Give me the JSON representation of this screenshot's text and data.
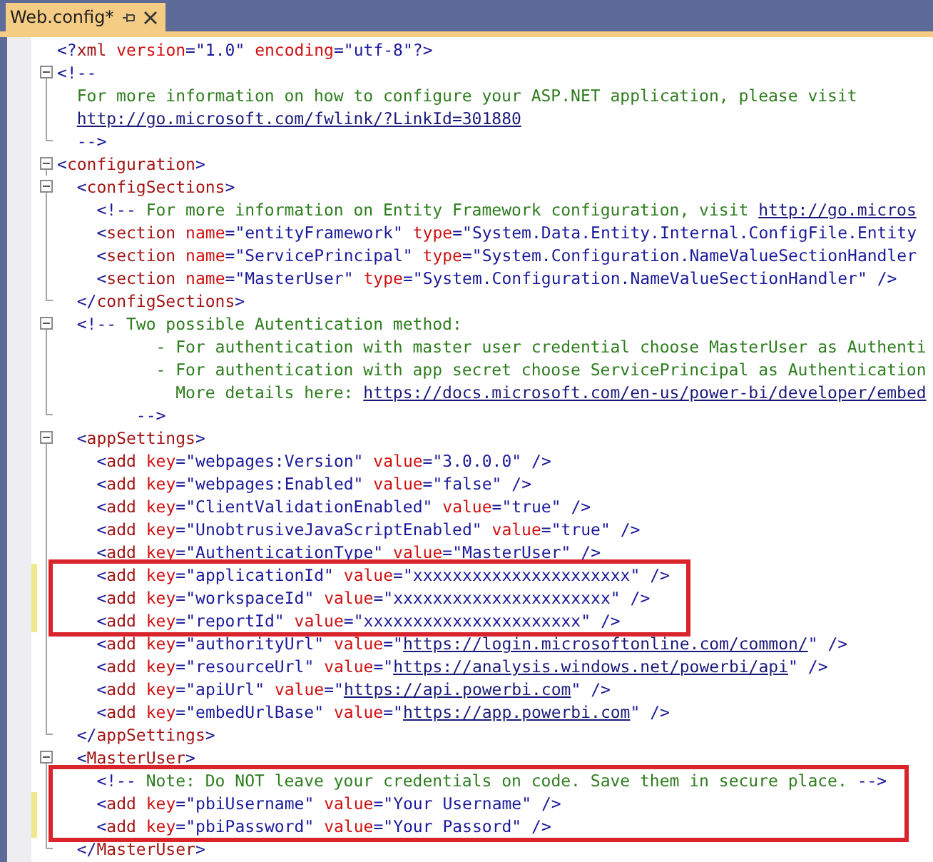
{
  "tab": {
    "title": "Web.config*",
    "selected": true
  },
  "editor": {
    "blocks": [
      {
        "highlighted": false,
        "lines": [
          {
            "kind": "plain",
            "modified": false,
            "segments": [
              {
                "kind": "markup",
                "text": "<?xml version=\"1.0\" encoding=\"utf-8\"?>"
              }
            ]
          },
          {
            "kind": "start",
            "expanded": true,
            "modified": false,
            "segments": [
              {
                "kind": "comment",
                "text": "<!--"
              }
            ]
          },
          {
            "kind": "line",
            "modified": false,
            "segments": [
              {
                "kind": "comment",
                "text": "  For more information on how to configure your ASP.NET application, please visit"
              }
            ]
          },
          {
            "kind": "line",
            "modified": false,
            "segments": [
              {
                "kind": "link",
                "text": "  http://go.microsoft.com/fwlink/?LinkId=301880"
              }
            ]
          },
          {
            "kind": "end",
            "modified": false,
            "segments": [
              {
                "kind": "comment",
                "text": "  -->"
              }
            ]
          },
          {
            "kind": "start",
            "expanded": true,
            "modified": false,
            "segments": [
              {
                "kind": "markup",
                "text": "<configuration>"
              }
            ]
          },
          {
            "kind": "start",
            "expanded": true,
            "modified": false,
            "segments": [
              {
                "kind": "markup",
                "text": "  <configSections>"
              }
            ]
          },
          {
            "kind": "line",
            "modified": false,
            "segments": [
              {
                "kind": "comment",
                "text": "    <!-- For more information on Entity Framework configuration, visit "
              },
              {
                "kind": "link",
                "text": "http://go.micros"
              }
            ]
          },
          {
            "kind": "line",
            "modified": false,
            "segments": [
              {
                "kind": "markup",
                "text": "    <section name=\"entityFramework\" type=\"System.Data.Entity.Internal.ConfigFile.Entity"
              }
            ]
          },
          {
            "kind": "line",
            "modified": false,
            "segments": [
              {
                "kind": "markup",
                "text": "    <section name=\"ServicePrincipal\" type=\"System.Configuration.NameValueSectionHandler"
              }
            ]
          },
          {
            "kind": "line",
            "modified": false,
            "segments": [
              {
                "kind": "markup",
                "text": "    <section name=\"MasterUser\" type=\"System.Configuration.NameValueSectionHandler\" />"
              }
            ]
          },
          {
            "kind": "end",
            "modified": false,
            "segments": [
              {
                "kind": "markup",
                "text": "  </configSections>"
              }
            ]
          },
          {
            "kind": "start",
            "expanded": true,
            "modified": false,
            "segments": [
              {
                "kind": "comment",
                "text": "  <!-- Two possible Autentication method:"
              }
            ]
          },
          {
            "kind": "line",
            "modified": false,
            "segments": [
              {
                "kind": "comment",
                "text": "          - For authentication with master user credential choose MasterUser as Authenti"
              }
            ]
          },
          {
            "kind": "line",
            "modified": false,
            "segments": [
              {
                "kind": "comment",
                "text": "          - For authentication with app secret choose ServicePrincipal as Authentication"
              }
            ]
          },
          {
            "kind": "line",
            "modified": false,
            "segments": [
              {
                "kind": "comment",
                "text": "            More details here: "
              },
              {
                "kind": "link",
                "text": "https://docs.microsoft.com/en-us/power-bi/developer/embed"
              }
            ]
          },
          {
            "kind": "end",
            "modified": false,
            "segments": [
              {
                "kind": "comment",
                "text": "        -->"
              }
            ]
          },
          {
            "kind": "start",
            "expanded": true,
            "modified": false,
            "segments": [
              {
                "kind": "markup",
                "text": "  <appSettings>"
              }
            ]
          },
          {
            "kind": "line",
            "modified": false,
            "segments": [
              {
                "kind": "markup",
                "text": "    <add key=\"webpages:Version\" value=\"3.0.0.0\" />"
              }
            ]
          },
          {
            "kind": "line",
            "modified": false,
            "segments": [
              {
                "kind": "markup",
                "text": "    <add key=\"webpages:Enabled\" value=\"false\" />"
              }
            ]
          },
          {
            "kind": "line",
            "modified": false,
            "segments": [
              {
                "kind": "markup",
                "text": "    <add key=\"ClientValidationEnabled\" value=\"true\" />"
              }
            ]
          },
          {
            "kind": "line",
            "modified": false,
            "segments": [
              {
                "kind": "markup",
                "text": "    <add key=\"UnobtrusiveJavaScriptEnabled\" value=\"true\" />"
              }
            ]
          },
          {
            "kind": "line",
            "modified": false,
            "segments": [
              {
                "kind": "markup",
                "text": "    <add key=\"AuthenticationType\" value=\"MasterUser\" />"
              }
            ]
          }
        ]
      },
      {
        "highlighted": true,
        "lines": [
          {
            "kind": "line",
            "modified": true,
            "segments": [
              {
                "kind": "markup",
                "text": "    <add key=\"applicationId\" value=\"xxxxxxxxxxxxxxxxxxxxxx\" />"
              }
            ]
          },
          {
            "kind": "line",
            "modified": true,
            "segments": [
              {
                "kind": "markup",
                "text": "    <add key=\"workspaceId\" value=\"xxxxxxxxxxxxxxxxxxxxxx\" />"
              }
            ]
          },
          {
            "kind": "line",
            "modified": true,
            "segments": [
              {
                "kind": "markup",
                "text": "    <add key=\"reportId\" value=\"xxxxxxxxxxxxxxxxxxxxxx\" />"
              }
            ]
          }
        ]
      },
      {
        "highlighted": false,
        "lines": [
          {
            "kind": "line",
            "modified": false,
            "segments": [
              {
                "kind": "markup",
                "text": "    <add key=\"authorityUrl\" value=\""
              },
              {
                "kind": "link",
                "text": "https://login.microsoftonline.com/common/"
              },
              {
                "kind": "markup",
                "text": "\" />"
              }
            ]
          },
          {
            "kind": "line",
            "modified": false,
            "segments": [
              {
                "kind": "markup",
                "text": "    <add key=\"resourceUrl\" value=\""
              },
              {
                "kind": "link",
                "text": "https://analysis.windows.net/powerbi/api"
              },
              {
                "kind": "markup",
                "text": "\" />"
              }
            ]
          },
          {
            "kind": "line",
            "modified": false,
            "segments": [
              {
                "kind": "markup",
                "text": "    <add key=\"apiUrl\" value=\""
              },
              {
                "kind": "link",
                "text": "https://api.powerbi.com"
              },
              {
                "kind": "markup",
                "text": "\" />"
              }
            ]
          },
          {
            "kind": "line",
            "modified": false,
            "segments": [
              {
                "kind": "markup",
                "text": "    <add key=\"embedUrlBase\" value=\""
              },
              {
                "kind": "link",
                "text": "https://app.powerbi.com"
              },
              {
                "kind": "markup",
                "text": "\" />"
              }
            ]
          },
          {
            "kind": "end",
            "modified": false,
            "segments": [
              {
                "kind": "markup",
                "text": "  </appSettings>"
              }
            ]
          },
          {
            "kind": "start",
            "expanded": true,
            "modified": false,
            "segments": [
              {
                "kind": "markup",
                "text": "  <MasterUser>"
              }
            ]
          }
        ]
      },
      {
        "highlighted": true,
        "lines": [
          {
            "kind": "line",
            "modified": false,
            "segments": [
              {
                "kind": "comment",
                "text": "    <!-- Note: Do NOT leave your credentials on code. Save them in secure place. -->"
              }
            ]
          },
          {
            "kind": "line",
            "modified": true,
            "segments": [
              {
                "kind": "markup",
                "text": "    <add key=\"pbiUsername\" value=\"Your Username\" />"
              }
            ]
          },
          {
            "kind": "line",
            "modified": true,
            "segments": [
              {
                "kind": "markup",
                "text": "    <add key=\"pbiPassword\" value=\"Your Passord\" />"
              }
            ]
          }
        ]
      },
      {
        "highlighted": false,
        "lines": [
          {
            "kind": "end",
            "modified": false,
            "segments": [
              {
                "kind": "markup",
                "text": "  </MasterUser>"
              }
            ]
          }
        ]
      }
    ]
  }
}
